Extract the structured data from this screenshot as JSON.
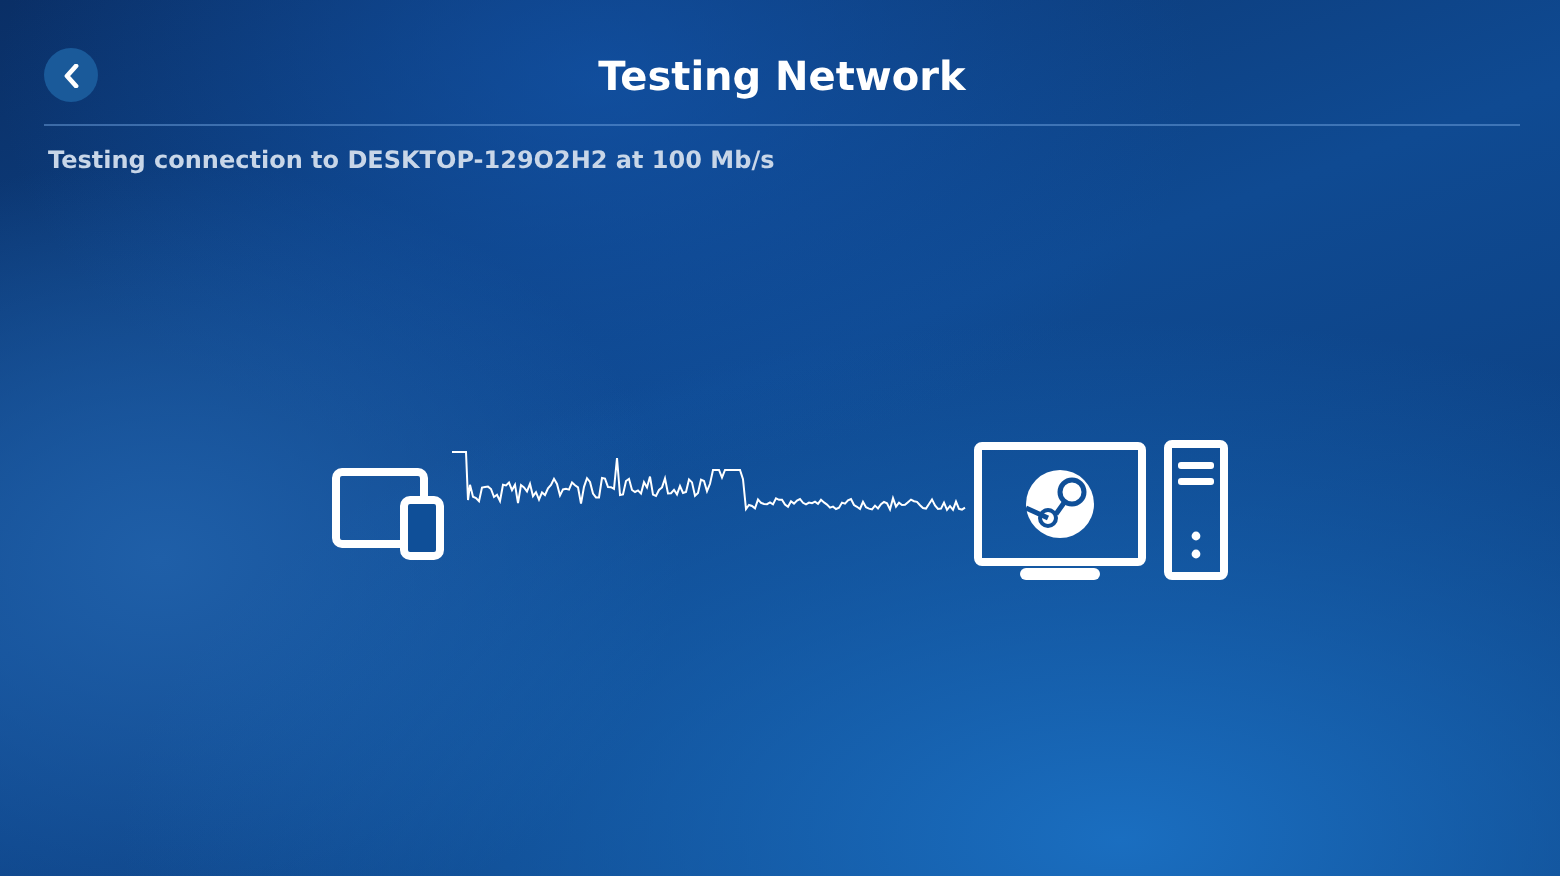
{
  "header": {
    "title": "Testing Network"
  },
  "status": "Testing connection to DESKTOP-129O2H2 at 100 Mb/s"
}
